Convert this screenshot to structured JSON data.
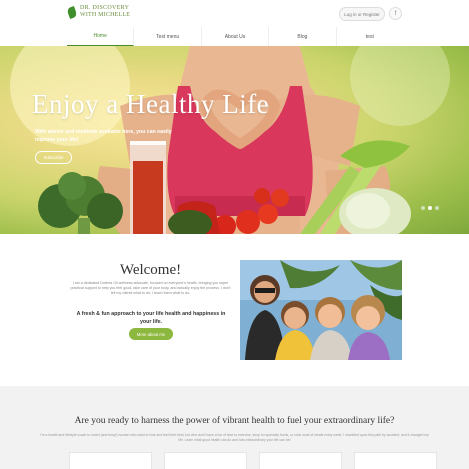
{
  "header": {
    "logo_line1": "DR. DISCOVERY",
    "logo_line2": "WITH MICHELLE",
    "login_label": "Log in or Register",
    "fb_label": "f"
  },
  "nav": {
    "items": [
      "Home",
      "Test menu",
      "About Us",
      "Blog",
      "test"
    ]
  },
  "hero": {
    "title": "Enjoy a Healthy Life",
    "subtitle": "With advice and methods available here, you can easily improve your life!",
    "button": "Subscribe"
  },
  "welcome": {
    "title": "Welcome!",
    "text": "I am a dedicated Doterra Oil wellness advocate, focused on everyone's health, bringing you super practical support to help you feel good, take care of your body, and actually enjoy the process. I don't tell my clients what to do; I teach them what to do.",
    "tagline": "A fresh & fun approach to your life health and happiness in your life.",
    "button": "More about me"
  },
  "bottom": {
    "title": "Are you ready to harness the power of vibrant health to fuel your extraordinary life?",
    "text": "I'm a health and lifestyle coach to smart (and busy!) women who want to look and feel their best, but who don't have a ton of time to exercise, shop for specialty foods, or cook most of meals every week. I stumbled upon this path by accident, and it changed my life. Learn what good health can do and how extraordinary your life can be!"
  },
  "colors": {
    "accent": "#8db83f",
    "nav_active": "#4a8b2e",
    "hero_bg": "#c9d46a",
    "bottom_bg": "#f2f2f2"
  }
}
